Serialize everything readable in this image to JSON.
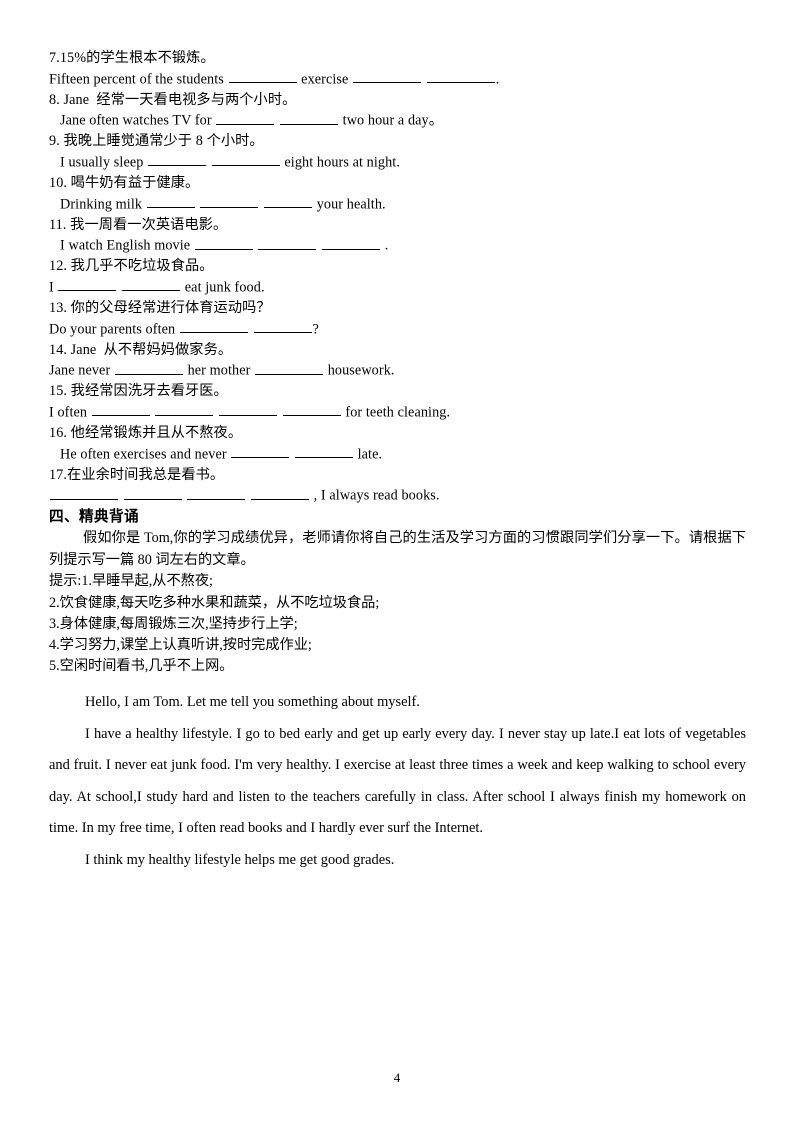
{
  "document": {
    "page_number": "4",
    "exercises": [
      {
        "cn": "7.15%的学生根本不锻炼。",
        "en_prefix": "Fifteen percent of the students ",
        "en_mid": " exercise ",
        "en_suffix": "."
      },
      {
        "cn": "8. Jane  经常一天看电视多与两个小时。",
        "en_prefix": "Jane often watches TV for ",
        "en_suffix": " two hour a day。"
      },
      {
        "cn": "9. 我晚上睡觉通常少于 8 个小时。",
        "en_prefix": "I usually sleep ",
        "en_suffix": " eight hours at night."
      },
      {
        "cn": "10. 喝牛奶有益于健康。",
        "en_prefix": "Drinking milk ",
        "en_suffix": " your health."
      },
      {
        "cn": "11. 我一周看一次英语电影。",
        "en_prefix": "I watch English movie ",
        "en_suffix": " ."
      },
      {
        "cn": "12. 我几乎不吃垃圾食品。",
        "en_prefix": "I ",
        "en_suffix": " eat junk food."
      },
      {
        "cn": "13. 你的父母经常进行体育运动吗？",
        "en_prefix": "Do your parents often ",
        "en_suffix": "?"
      },
      {
        "cn": "14. Jane  从不帮妈妈做家务。",
        "en_prefix": "Jane never ",
        "en_mid": " her mother ",
        "en_suffix": " housework."
      },
      {
        "cn": "15. 我经常因洗牙去看牙医。",
        "en_prefix": "I often ",
        "en_suffix": " for teeth cleaning."
      },
      {
        "cn": "16. 他经常锻炼并且从不熬夜。",
        "en_prefix": "He often exercises and never ",
        "en_suffix": " late."
      },
      {
        "cn": "17.在业余时间我总是看书。",
        "en_prefix": "",
        "en_suffix": " , I always read books."
      }
    ],
    "section": {
      "heading": "四、精典背诵",
      "prompt": "假如你是 Tom,你的学习成绩优异，老师请你将自己的生活及学习方面的习惯跟同学们分享一下。请根据下列提示写一篇 80 词左右的文章。",
      "hints": [
        "提示:1.早睡早起,从不熬夜;",
        "2.饮食健康,每天吃多种水果和蔬菜，从不吃垃圾食品;",
        "3.身体健康,每周锻炼三次,坚持步行上学;",
        "4.学习努力,课堂上认真听讲,按时完成作业;",
        "5.空闲时间看书,几乎不上网。"
      ]
    },
    "essay": {
      "opening_underlined": "Hello, I am Tom. Let me tell you something about myself.",
      "body_underlined_lead": "I have a healthy lifestyle.",
      "body_rest": " I go to bed early and get up early every day. I never stay up late.I eat lots of vegetables and fruit. I never eat junk food. I'm very healthy. I exercise at least three times a week and keep walking to school every day. At school,I study hard and listen to the teachers carefully in class. After school I always finish my homework on time. In my free time, I often read books and I hardly ever surf the Internet.",
      "closing_underlined": "I think my healthy lifestyle helps me get good grades."
    }
  }
}
